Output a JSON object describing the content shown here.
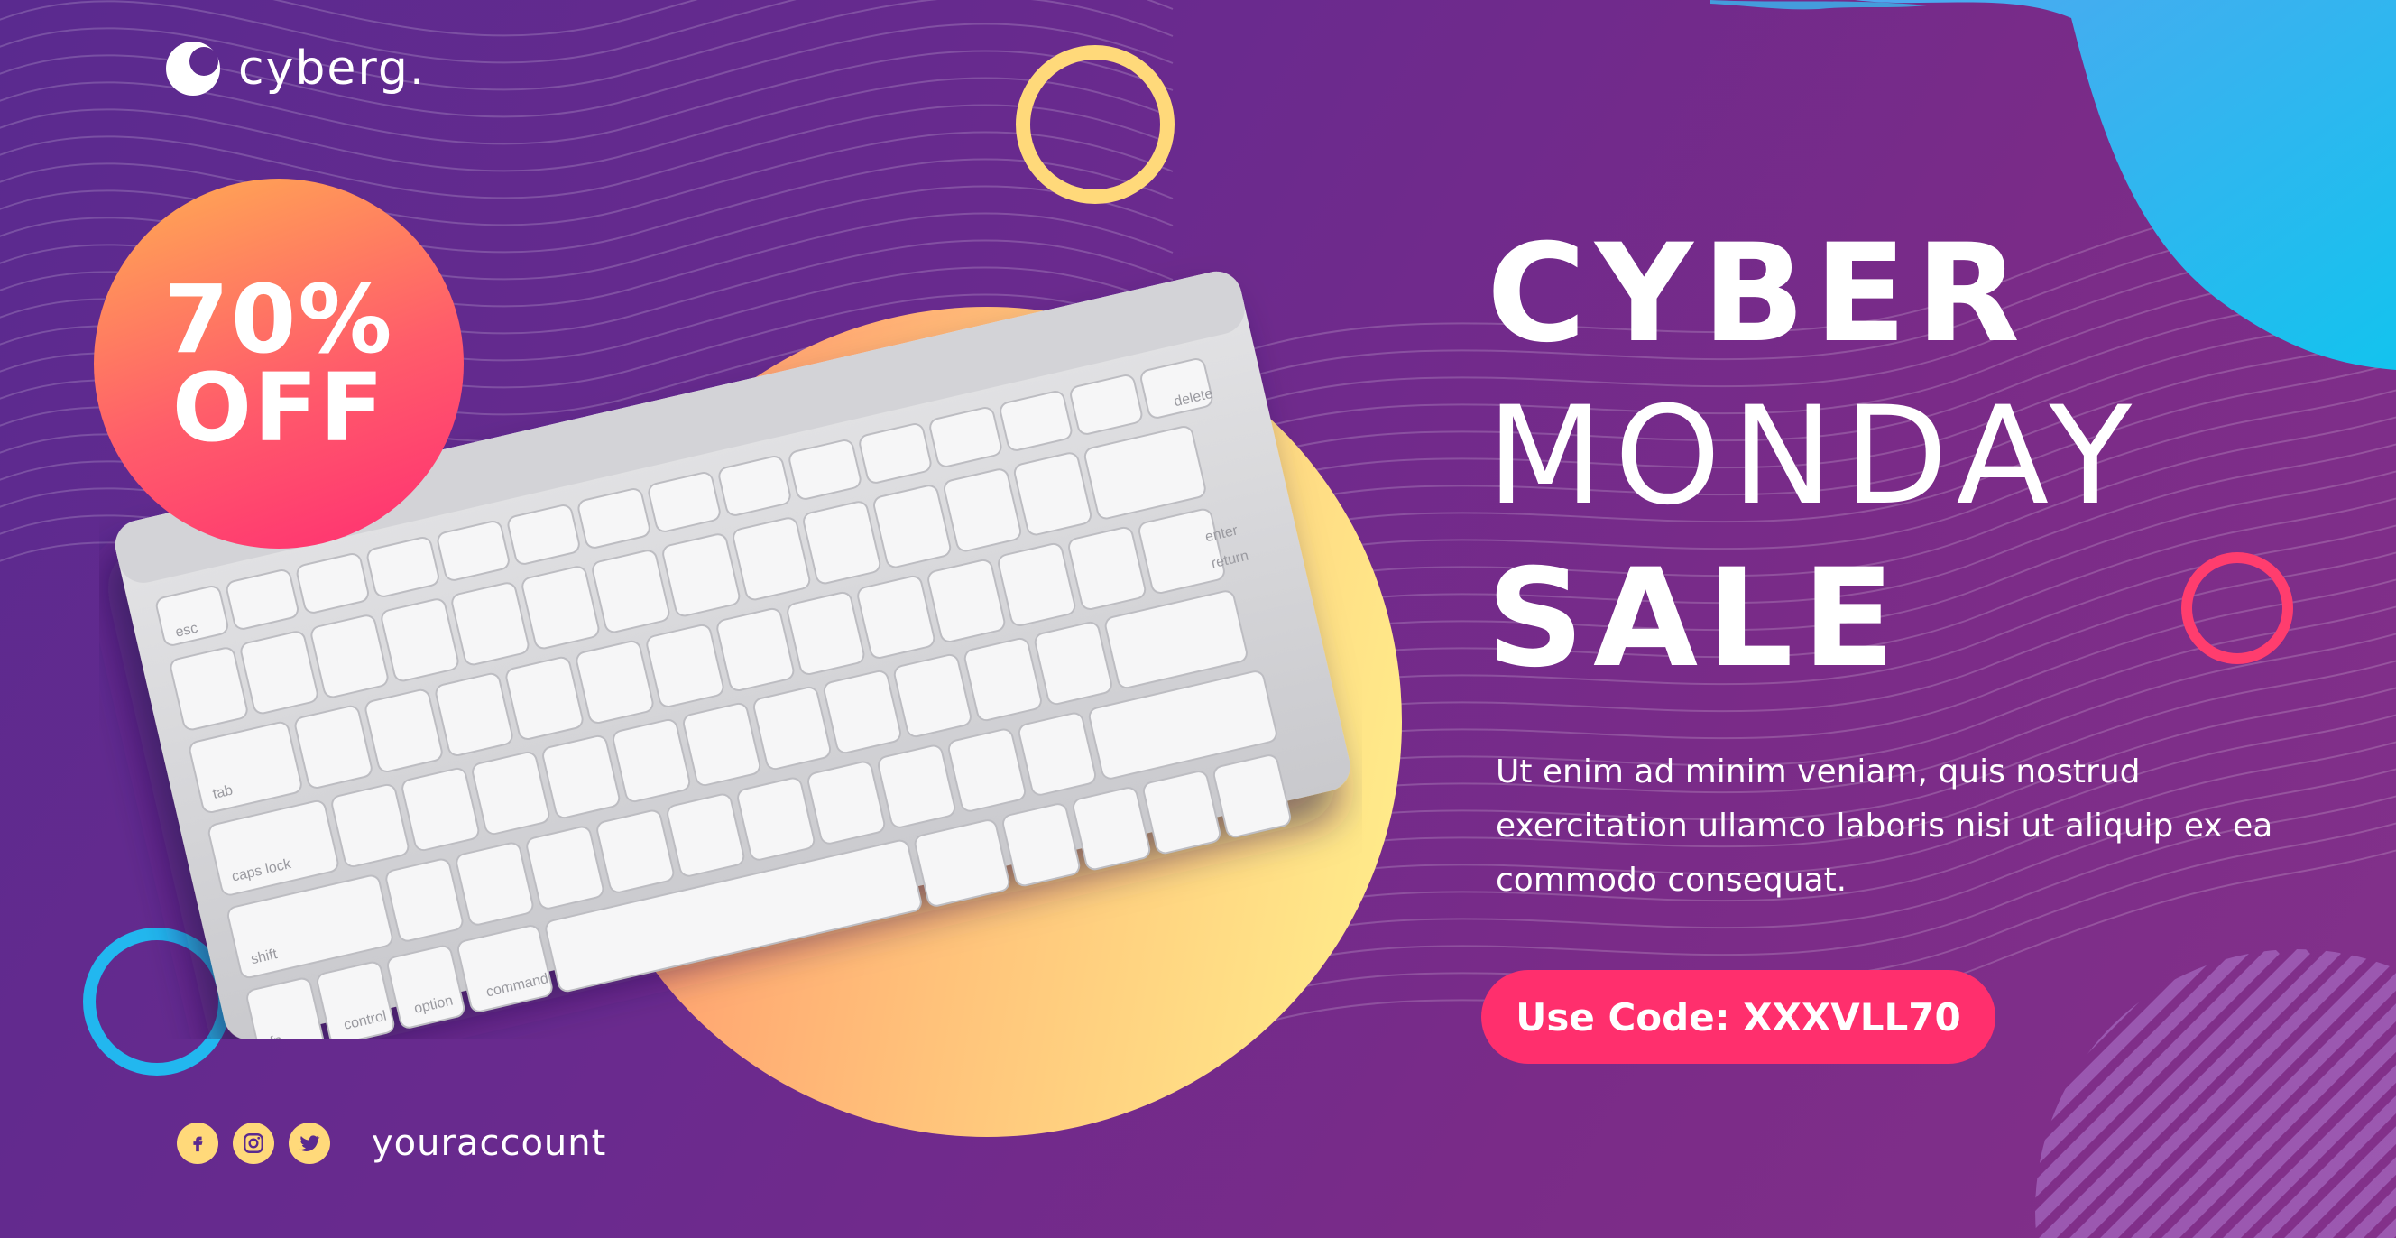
{
  "brand": {
    "name": "cyberg.",
    "icon": "moon-logo-icon"
  },
  "badge": {
    "line1": "70%",
    "line2": "OFF"
  },
  "headline": {
    "line1": "CYBER",
    "line2": "MONDAY",
    "line3": "SALE"
  },
  "description": "Ut enim ad minim veniam, quis nostrud exercitation ullamco laboris nisi ut aliquip ex ea commodo consequat.",
  "cta": {
    "label": "Use Code: XXXVLL70"
  },
  "social": {
    "icons": [
      "facebook-icon",
      "instagram-icon",
      "twitter-icon"
    ],
    "handle": "youraccount"
  },
  "keyboard": {
    "key_labels": [
      "esc",
      "tab",
      "caps lock",
      "shift",
      "fn",
      "control",
      "option",
      "command",
      "delete",
      "return",
      "enter"
    ]
  },
  "colors": {
    "background_start": "#5a2a8f",
    "background_end": "#83318a",
    "accent_pink": "#ff2f6d",
    "accent_yellow": "#ffd97a",
    "accent_blue": "#22b7ef",
    "text": "#ffffff"
  }
}
